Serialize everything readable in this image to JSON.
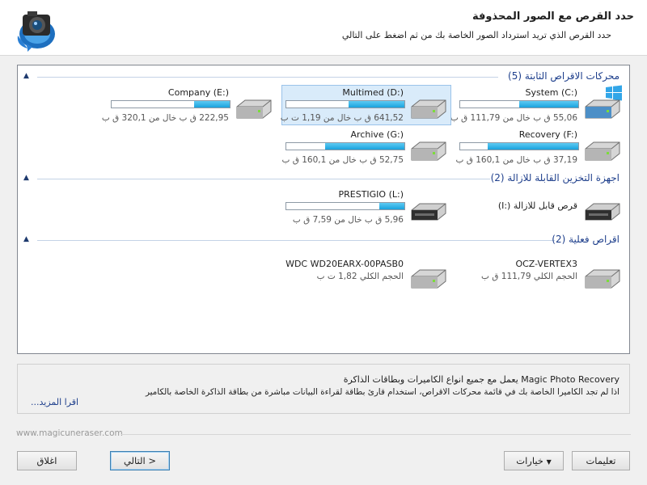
{
  "header": {
    "title": "حدد القرص مع الصور المحذوفة",
    "subtitle": "حدد القرص الذي تريد استرداد الصور الخاصة بك من ثم اضغط على التالي"
  },
  "groups": [
    {
      "title": "محركات الاقراص الثابتة (5)",
      "drives": [
        {
          "name": "System (C:)",
          "info": "55,06 ق ب خال من 111,79 ق ب",
          "used_fraction": 0.5,
          "selected": false,
          "os_drive": true
        },
        {
          "name": "Multimed (D:)",
          "info": "641,52 ق ب خال من 1,19 ت ب",
          "used_fraction": 0.47,
          "selected": true
        },
        {
          "name": "Company (E:)",
          "info": "222,95 ق ب خال من 320,1 ق ب",
          "used_fraction": 0.3
        },
        {
          "name": "Recovery (F:)",
          "info": "37,19 ق ب خال من 160,1 ق ب",
          "used_fraction": 0.77
        },
        {
          "name": "Archive (G:)",
          "info": "52,75 ق ب خال من 160,1 ق ب",
          "used_fraction": 0.67
        }
      ]
    },
    {
      "title": "اجهزة التخزين القابلة للازالة (2)",
      "drives": [
        {
          "name": "(I:) قرص قابل للازالة",
          "info": ""
        },
        {
          "name": "PRESTIGIO (L:)",
          "info": "5,96 ق ب خال من 7,59 ق ب",
          "used_fraction": 0.21
        }
      ]
    },
    {
      "title": "اقراص فعلية (2)",
      "drives": [
        {
          "name": "OCZ-VERTEX3",
          "info": "الحجم الكلي 111,79 ق ب"
        },
        {
          "name": "WDC WD20EARX-00PASB0",
          "info": "الحجم الكلي 1,82 ت ب"
        }
      ]
    }
  ],
  "info_box": {
    "line1": "Magic Photo Recovery يعمل مع جميع انواع الكاميرات وبطاقات الذاكرة",
    "line2": "اذا لم تجد الكاميرا الخاصة بك في قائمة محركات الاقراص، استخدام قارئ بطاقة لقراءة البيانات مباشرة من بطاقة الذاكرة الخاصة بالكامير",
    "more_link": "اقرا المزيد..."
  },
  "footer": {
    "url": "www.magicuneraser.com",
    "help_button": "تعليمات",
    "options_button": "خيارات",
    "next_button": "التالي >",
    "close_button": "اغلاق"
  },
  "colors": {
    "accent": "#1e3f8c",
    "bar_fill": "#1aa2dd",
    "selection": "#d9ebfa"
  }
}
